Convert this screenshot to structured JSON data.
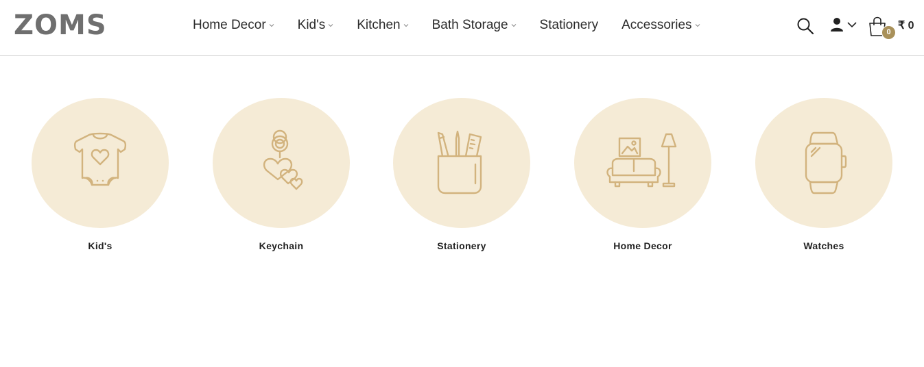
{
  "brand": {
    "logo_text": "ZOMS"
  },
  "nav": {
    "items": [
      {
        "label": "Home Decor",
        "has_dropdown": true
      },
      {
        "label": "Kid's",
        "has_dropdown": true
      },
      {
        "label": "Kitchen",
        "has_dropdown": true
      },
      {
        "label": "Bath Storage",
        "has_dropdown": true
      },
      {
        "label": "Stationery",
        "has_dropdown": false
      },
      {
        "label": "Accessories",
        "has_dropdown": true
      }
    ]
  },
  "header_actions": {
    "search_icon": "search-icon",
    "account_icon": "user-icon",
    "cart_icon": "shopping-bag-icon",
    "cart_count": "0",
    "cart_total": "₹ 0"
  },
  "categories": [
    {
      "label": "Kid's",
      "icon": "onesie-icon"
    },
    {
      "label": "Keychain",
      "icon": "keychain-icon"
    },
    {
      "label": "Stationery",
      "icon": "pencil-cup-icon"
    },
    {
      "label": "Home Decor",
      "icon": "sofa-lamp-icon"
    },
    {
      "label": "Watches",
      "icon": "watch-icon"
    }
  ],
  "colors": {
    "circle_bg": "#f5ebd6",
    "icon_stroke": "#d2b37e",
    "badge_bg": "#a9915a",
    "logo": "#6f6f6f"
  }
}
